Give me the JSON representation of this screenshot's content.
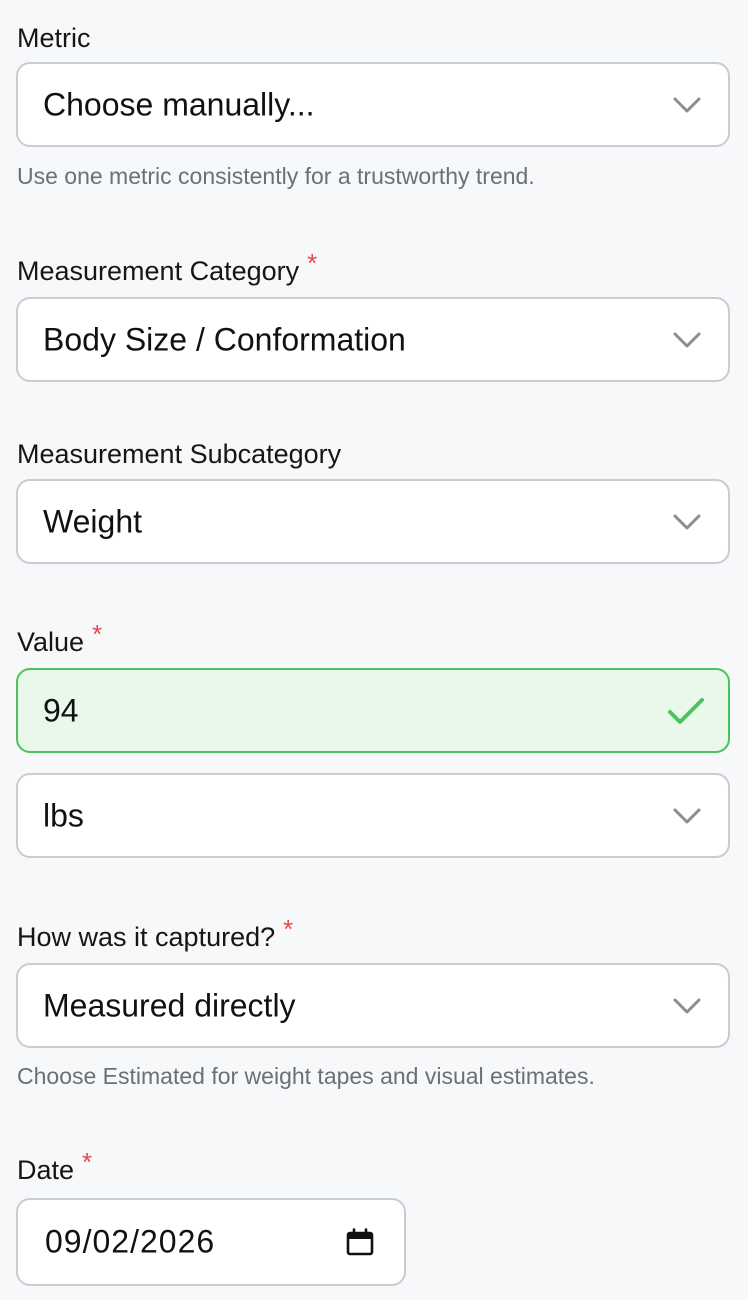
{
  "fields": {
    "metric": {
      "label": "Metric",
      "selected": "Choose manually...",
      "hint": "Use one metric consistently for a trustworthy trend."
    },
    "category": {
      "label": "Measurement Category",
      "required_mark": "*",
      "selected": "Body Size / Conformation"
    },
    "subcategory": {
      "label": "Measurement Subcategory",
      "selected": "Weight"
    },
    "value": {
      "label": "Value",
      "required_mark": "*",
      "input_value": "94",
      "status": "valid",
      "unit_selected": "lbs"
    },
    "capture": {
      "label": "How was it captured?",
      "required_mark": "*",
      "selected": "Measured directly",
      "hint": "Choose Estimated for weight tapes and visual estimates."
    },
    "date": {
      "label": "Date",
      "required_mark": "*",
      "value": "09/02/2026"
    }
  },
  "icons": {
    "dropdown": "chevron-down-icon",
    "valid": "checkmark-icon",
    "calendar": "calendar-icon"
  },
  "colors": {
    "required": "#e5484d",
    "valid_border": "#4cc25c",
    "valid_background": "#eaf8ec",
    "hint_text": "#6b6f76",
    "border": "#c9ccd1"
  }
}
